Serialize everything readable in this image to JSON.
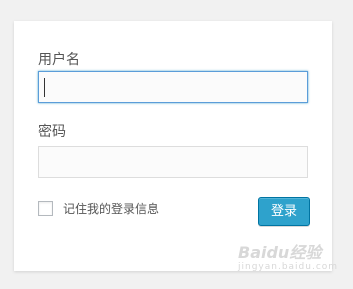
{
  "form": {
    "username_label": "用户名",
    "username_value": "",
    "password_label": "密码",
    "password_value": "",
    "remember_label": "记住我的登录信息",
    "remember_checked": false,
    "submit_label": "登录"
  },
  "watermark": {
    "logo": "Baidu经验",
    "sub": "jingyan.baidu.com"
  },
  "colors": {
    "page_background": "#f1f1f1",
    "card_background": "#ffffff",
    "focus_border": "#5b9dd9",
    "button_background": "#2ea2cc",
    "button_border": "#0074a2"
  }
}
